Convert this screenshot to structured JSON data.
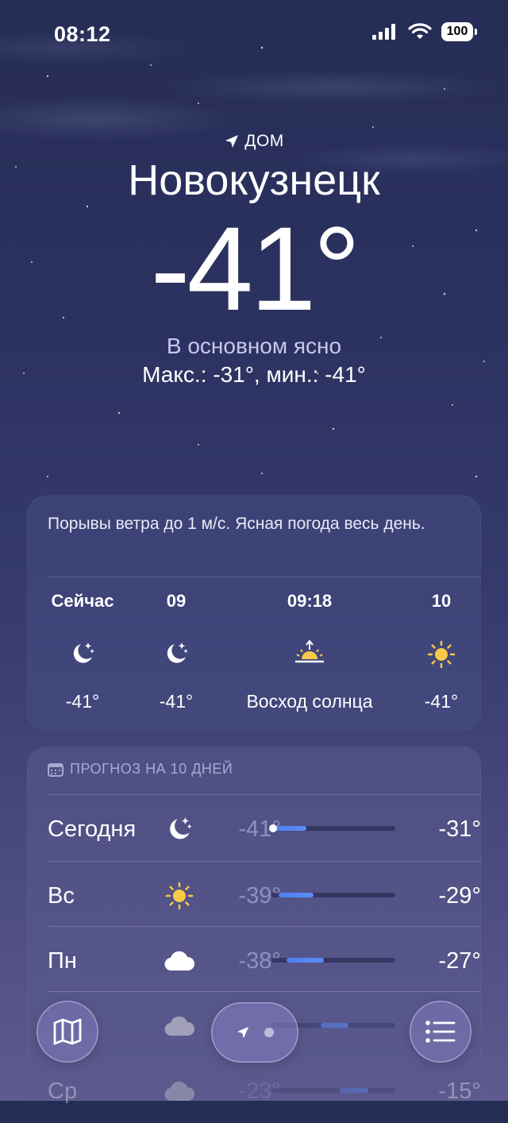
{
  "status_bar": {
    "time": "08:12",
    "battery": "100"
  },
  "header": {
    "location_label": "ДОМ",
    "city": "Новокузнецк",
    "temperature": "-41°",
    "condition": "В основном ясно",
    "high_low": "Макс.: -31°, мин.: -41°"
  },
  "hourly": {
    "summary": "Порывы ветра до 1 м/с. Ясная погода весь день.",
    "items": [
      {
        "time": "Сейчас",
        "icon": "moon-stars-icon",
        "value": "-41°"
      },
      {
        "time": "09",
        "icon": "moon-stars-icon",
        "value": "-41°"
      },
      {
        "time": "09:18",
        "icon": "sunrise-icon",
        "value": "Восход солнца"
      },
      {
        "time": "10",
        "icon": "sun-icon",
        "value": "-41°"
      }
    ]
  },
  "forecast": {
    "title": "ПРОГНОЗ НА 10 ДНЕЙ",
    "days": [
      {
        "day": "Сегодня",
        "icon": "moon-stars-icon",
        "low": "-41°",
        "high": "-31°",
        "range": [
          0.0,
          0.28
        ],
        "current": 0.0
      },
      {
        "day": "Вс",
        "icon": "sun-icon",
        "low": "-39°",
        "high": "-29°",
        "range": [
          0.06,
          0.34
        ]
      },
      {
        "day": "Пн",
        "icon": "cloud-icon",
        "low": "-38°",
        "high": "-27°",
        "range": [
          0.12,
          0.42
        ]
      },
      {
        "day": "",
        "icon": "cloud-icon",
        "low": "",
        "high": "",
        "range": [
          0.4,
          0.62
        ]
      },
      {
        "day": "Ср",
        "icon": "cloud-icon",
        "low": "-23°",
        "high": "-15°",
        "range": [
          0.55,
          0.78
        ]
      }
    ]
  },
  "nav": {
    "map": "map-icon",
    "locations": "location-arrow-icon",
    "list": "list-icon"
  }
}
